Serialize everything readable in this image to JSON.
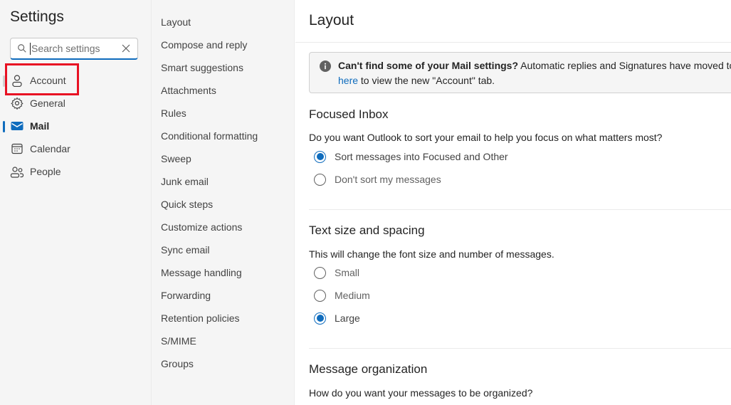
{
  "nav": {
    "title": "Settings",
    "search": {
      "placeholder": "Search settings",
      "value": ""
    },
    "items": [
      {
        "label": "Account",
        "icon": "person-icon"
      },
      {
        "label": "General",
        "icon": "gear-icon"
      },
      {
        "label": "Mail",
        "icon": "mail-icon",
        "active": true
      },
      {
        "label": "Calendar",
        "icon": "calendar-icon"
      },
      {
        "label": "People",
        "icon": "people-icon"
      }
    ],
    "highlighted_item": "Account"
  },
  "subnav": {
    "items": [
      {
        "label": "Layout"
      },
      {
        "label": "Compose and reply"
      },
      {
        "label": "Smart suggestions"
      },
      {
        "label": "Attachments"
      },
      {
        "label": "Rules"
      },
      {
        "label": "Conditional formatting"
      },
      {
        "label": "Sweep"
      },
      {
        "label": "Junk email"
      },
      {
        "label": "Quick steps"
      },
      {
        "label": "Customize actions"
      },
      {
        "label": "Sync email"
      },
      {
        "label": "Message handling"
      },
      {
        "label": "Forwarding"
      },
      {
        "label": "Retention policies"
      },
      {
        "label": "S/MIME"
      },
      {
        "label": "Groups"
      }
    ]
  },
  "content": {
    "title": "Layout",
    "info": {
      "bold": "Can't find some of your Mail settings?",
      "text": " Automatic replies and Signatures have moved to t",
      "link": "here",
      "text2": " to view the new \"Account\" tab."
    },
    "sections": [
      {
        "title": "Focused Inbox",
        "description": "Do you want Outlook to sort your email to help you focus on what matters most?",
        "options": [
          {
            "label": "Sort messages into Focused and Other",
            "checked": true
          },
          {
            "label": "Don't sort my messages",
            "checked": false
          }
        ]
      },
      {
        "title": "Text size and spacing",
        "description": "This will change the font size and number of messages.",
        "options": [
          {
            "label": "Small",
            "checked": false
          },
          {
            "label": "Medium",
            "checked": false
          },
          {
            "label": "Large",
            "checked": true
          }
        ]
      },
      {
        "title": "Message organization",
        "description": "How do you want your messages to be organized?"
      }
    ]
  },
  "colors": {
    "accent": "#0f6cbd",
    "highlight_box": "#e81123",
    "nav_background": "#f5f5f5"
  }
}
